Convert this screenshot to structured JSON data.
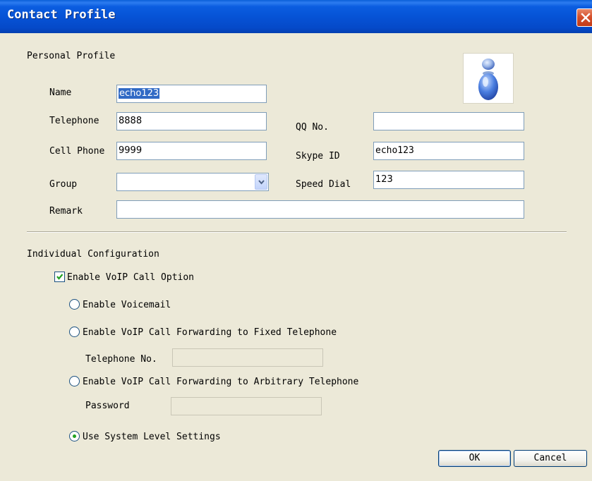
{
  "window": {
    "title": "Contact Profile"
  },
  "personal": {
    "section_title": "Personal Profile",
    "name_label": "Name",
    "name_value": "echo123",
    "telephone_label": "Telephone",
    "telephone_value": "8888",
    "cell_label": "Cell Phone",
    "cell_value": "9999",
    "group_label": "Group",
    "group_value": "",
    "remark_label": "Remark",
    "remark_value": "",
    "qq_label": "QQ No.",
    "qq_value": "",
    "skype_label": "Skype ID",
    "skype_value": "echo123",
    "speed_label": "Speed Dial",
    "speed_value": "123"
  },
  "config": {
    "section_title": "Individual Configuration",
    "enable_voip_label": "Enable VoIP Call Option",
    "enable_voip_checked": true,
    "voicemail_label": "Enable Voicemail",
    "fwd_fixed_label": "Enable VoIP Call Forwarding to Fixed Telephone",
    "telephone_no_label": "Telephone No.",
    "telephone_no_value": "",
    "fwd_arbitrary_label": "Enable VoIP Call Forwarding to Arbitrary Telephone",
    "password_label": "Password",
    "password_value": "",
    "system_level_label": "Use System Level Settings",
    "selected_option": "system_level"
  },
  "buttons": {
    "ok": "OK",
    "cancel": "Cancel"
  },
  "icons": {
    "close": "close-icon",
    "avatar": "contact-avatar-icon",
    "dropdown": "chevron-down-icon",
    "check": "checkmark-icon"
  }
}
